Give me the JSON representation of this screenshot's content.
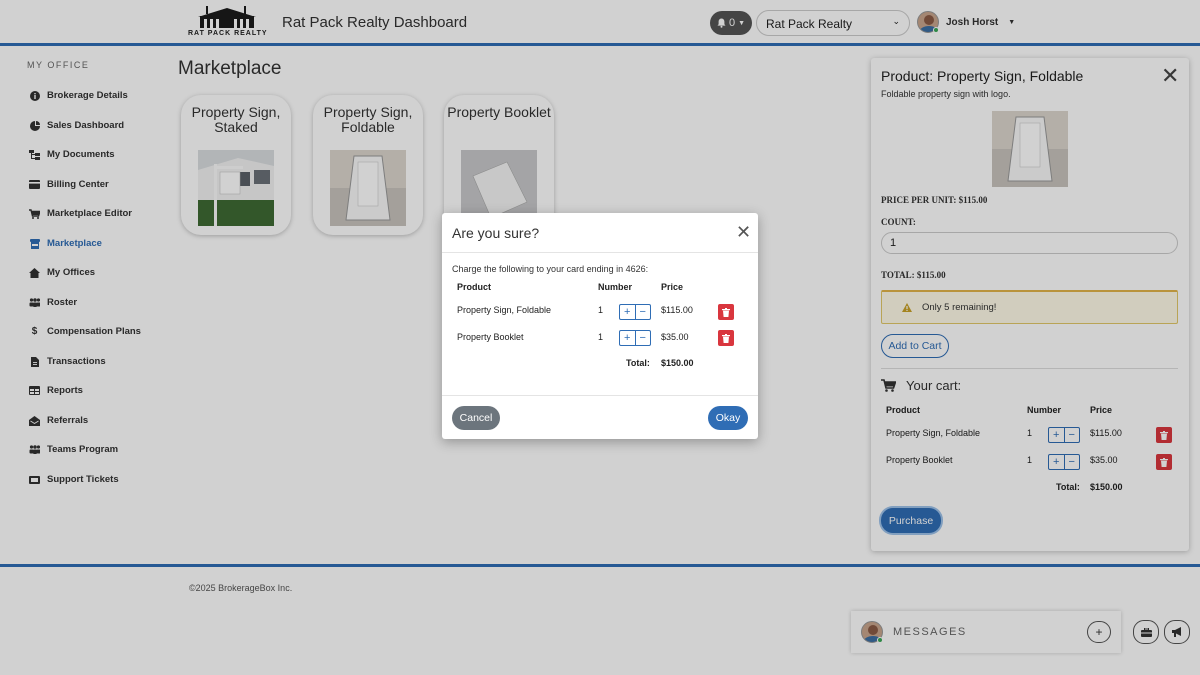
{
  "header": {
    "logo_text": "RAT PACK REALTY",
    "app_title": "Rat Pack Realty Dashboard",
    "notification_count": "0",
    "office_select": "Rat Pack Realty",
    "user_name": "Josh Horst"
  },
  "sidebar": {
    "heading": "MY OFFICE",
    "items": [
      {
        "label": "Brokerage Details",
        "icon": "info-icon"
      },
      {
        "label": "Sales Dashboard",
        "icon": "pie-chart-icon"
      },
      {
        "label": "My Documents",
        "icon": "folder-tree-icon"
      },
      {
        "label": "Billing Center",
        "icon": "credit-card-icon"
      },
      {
        "label": "Marketplace Editor",
        "icon": "cart-icon"
      },
      {
        "label": "Marketplace",
        "icon": "store-icon"
      },
      {
        "label": "My Offices",
        "icon": "home-icon"
      },
      {
        "label": "Roster",
        "icon": "users-icon"
      },
      {
        "label": "Compensation Plans",
        "icon": "dollar-icon"
      },
      {
        "label": "Transactions",
        "icon": "file-icon"
      },
      {
        "label": "Reports",
        "icon": "table-icon"
      },
      {
        "label": "Referrals",
        "icon": "envelope-open-icon"
      },
      {
        "label": "Teams Program",
        "icon": "users-icon"
      },
      {
        "label": "Support Tickets",
        "icon": "ticket-icon"
      }
    ],
    "active": "Marketplace"
  },
  "main": {
    "title": "Marketplace",
    "products": [
      {
        "name": "Property Sign, Staked"
      },
      {
        "name": "Property Sign, Foldable"
      },
      {
        "name": "Property Booklet"
      }
    ]
  },
  "panel": {
    "title": "Product: Property Sign, Foldable",
    "description": "Foldable property sign with logo.",
    "price_per_unit": "PRICE PER UNIT: $115.00",
    "count_label": "COUNT:",
    "count_value": "1",
    "total": "TOTAL: $115.00",
    "alert": "Only 5 remaining!",
    "add_to_cart": "Add to Cart",
    "cart_title": "Your cart:",
    "columns": [
      "Product",
      "Number",
      "Price"
    ],
    "rows": [
      {
        "product": "Property Sign, Foldable",
        "number": "1",
        "price": "$115.00"
      },
      {
        "product": "Property Booklet",
        "number": "1",
        "price": "$35.00"
      }
    ],
    "total_label": "Total:",
    "total_value": "$150.00",
    "purchase": "Purchase"
  },
  "footer": {
    "copyright": "©2025 BrokerageBox Inc."
  },
  "messages": {
    "label": "MESSAGES"
  },
  "modal": {
    "title": "Are you sure?",
    "text": "Charge the following to your card ending in 4626:",
    "columns": [
      "Product",
      "Number",
      "Price"
    ],
    "rows": [
      {
        "product": "Property Sign, Foldable",
        "number": "1",
        "price": "$115.00"
      },
      {
        "product": "Property Booklet",
        "number": "1",
        "price": "$35.00"
      }
    ],
    "total_label": "Total:",
    "total_value": "$150.00",
    "cancel": "Cancel",
    "ok": "Okay"
  },
  "colors": {
    "accent": "#2f6db5",
    "danger": "#d9363e",
    "warning": "#e2b44a"
  }
}
